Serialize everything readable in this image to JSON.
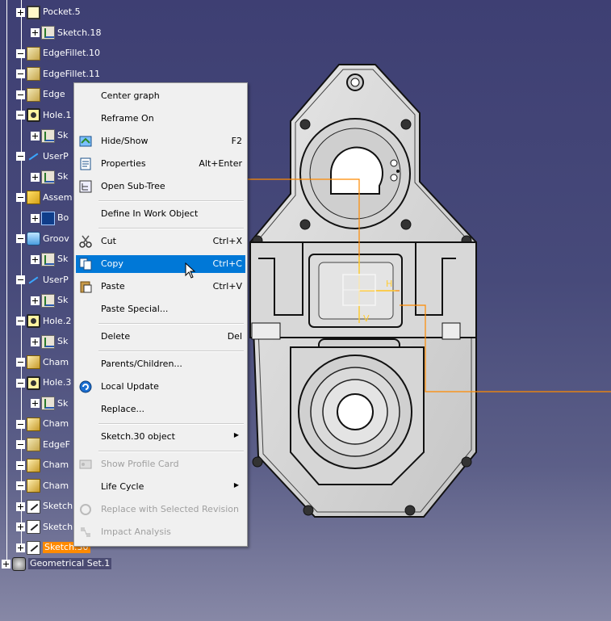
{
  "tree": {
    "items": [
      {
        "label": "Pocket.5",
        "icon": "pocket-icon"
      },
      {
        "label": "Sketch.18",
        "icon": "sketch-icon"
      },
      {
        "label": "EdgeFillet.10",
        "icon": "edge-fillet-icon"
      },
      {
        "label": "EdgeFillet.11",
        "icon": "edge-fillet-icon"
      },
      {
        "label": "Edge",
        "icon": "edge-fillet-icon"
      },
      {
        "label": "Hole.1",
        "icon": "hole-icon"
      },
      {
        "label": "Sk",
        "icon": "sketch-icon"
      },
      {
        "label": "UserP",
        "icon": "user-pattern-icon"
      },
      {
        "label": "Sk",
        "icon": "sketch-icon"
      },
      {
        "label": "Assem",
        "icon": "assemble-icon"
      },
      {
        "label": "Bo",
        "icon": "body-icon"
      },
      {
        "label": "Groov",
        "icon": "groove-icon"
      },
      {
        "label": "Sk",
        "icon": "sketch-icon"
      },
      {
        "label": "UserP",
        "icon": "user-pattern-icon"
      },
      {
        "label": "Sk",
        "icon": "sketch-icon"
      },
      {
        "label": "Hole.2",
        "icon": "hole-icon"
      },
      {
        "label": "Sk",
        "icon": "sketch-icon"
      },
      {
        "label": "Cham",
        "icon": "chamfer-icon"
      },
      {
        "label": "Hole.3",
        "icon": "hole-icon"
      },
      {
        "label": "Sk",
        "icon": "sketch-icon"
      },
      {
        "label": "Cham",
        "icon": "chamfer-icon"
      },
      {
        "label": "EdgeF",
        "icon": "edge-fillet-icon"
      },
      {
        "label": "Cham",
        "icon": "chamfer-icon"
      },
      {
        "label": "Cham",
        "icon": "chamfer-icon"
      },
      {
        "label": "Sketch",
        "icon": "sketch-tool-icon"
      },
      {
        "label": "Sketch",
        "icon": "sketch-tool-icon"
      },
      {
        "label": "Sketch.30",
        "icon": "sketch-tool-icon"
      },
      {
        "label": "Geometrical Set.1",
        "icon": "geometrical-set-icon"
      }
    ]
  },
  "context_menu": {
    "items": [
      {
        "label": "Center graph",
        "shortcut": ""
      },
      {
        "label": "Reframe On",
        "shortcut": ""
      },
      {
        "label": "Hide/Show",
        "shortcut": "F2",
        "icon": "hide-show-icon"
      },
      {
        "label": "Properties",
        "shortcut": "Alt+Enter",
        "icon": "properties-icon"
      },
      {
        "label": "Open Sub-Tree",
        "shortcut": "",
        "icon": "open-subtree-icon"
      },
      {
        "label": "Define In Work Object",
        "shortcut": ""
      },
      {
        "label": "Cut",
        "shortcut": "Ctrl+X",
        "icon": "scissors-icon"
      },
      {
        "label": "Copy",
        "shortcut": "Ctrl+C",
        "icon": "copy-icon",
        "active": true
      },
      {
        "label": "Paste",
        "shortcut": "Ctrl+V",
        "icon": "paste-icon"
      },
      {
        "label": "Paste Special...",
        "shortcut": ""
      },
      {
        "label": "Delete",
        "shortcut": "Del"
      },
      {
        "label": "Parents/Children...",
        "shortcut": ""
      },
      {
        "label": "Local Update",
        "shortcut": "",
        "icon": "local-update-icon"
      },
      {
        "label": "Replace...",
        "shortcut": ""
      },
      {
        "label": "Sketch.30 object",
        "shortcut": "",
        "submenu": true
      },
      {
        "label": "Show Profile Card",
        "shortcut": "",
        "icon": "profile-card-icon",
        "disabled": true
      },
      {
        "label": "Life Cycle",
        "shortcut": "",
        "submenu": true
      },
      {
        "label": "Replace with Selected Revision",
        "shortcut": "",
        "icon": "replace-revision-icon",
        "disabled": true
      },
      {
        "label": "Impact Analysis",
        "shortcut": "",
        "icon": "impact-analysis-icon",
        "disabled": true
      }
    ]
  },
  "viewport": {
    "axis_h_label": "H",
    "axis_v_label": "V",
    "colors": {
      "background_top": "#3e3f73",
      "background_bottom": "#8788a6",
      "part_fill": "#d9d9d9",
      "selection": "#ff8a00",
      "menu_highlight": "#0078d7"
    }
  }
}
